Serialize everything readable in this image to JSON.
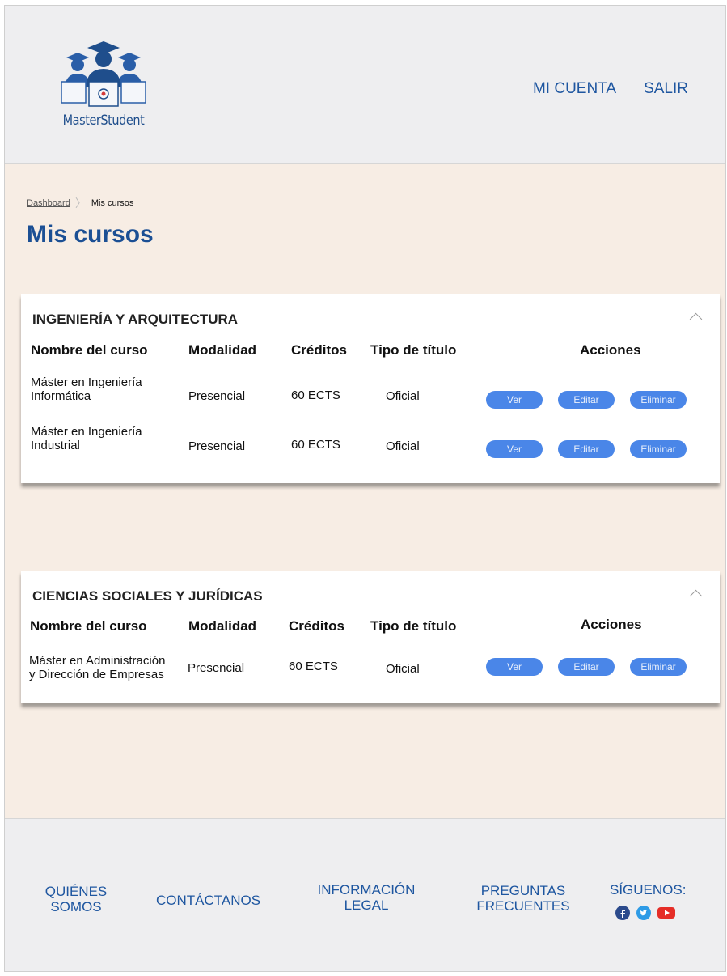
{
  "header": {
    "logo_text": "MasterStudent",
    "nav": [
      "MI CUENTA",
      "SALIR"
    ]
  },
  "breadcrumb": {
    "link": "Dashboard",
    "current": "Mis cursos"
  },
  "page_title": "Mis cursos",
  "columns": [
    "Nombre del curso",
    "Modalidad",
    "Créditos",
    "Tipo de título",
    "Acciones"
  ],
  "actions": [
    "Ver",
    "Editar",
    "Eliminar"
  ],
  "sections": [
    {
      "title": "INGENIERÍA Y ARQUITECTURA",
      "rows": [
        {
          "name_line1": "Máster en Ingeniería",
          "name_line2": "Informática",
          "modalidad": "Presencial",
          "creditos": "60 ECTS",
          "tipo": "Oficial"
        },
        {
          "name_line1": "Máster en Ingeniería",
          "name_line2": "Industrial",
          "modalidad": "Presencial",
          "creditos": "60 ECTS",
          "tipo": "Oficial"
        }
      ]
    },
    {
      "title": "CIENCIAS SOCIALES Y JURÍDICAS",
      "rows": [
        {
          "name_line1": "Máster en Administración",
          "name_line2": "y Dirección de Empresas",
          "modalidad": "Presencial",
          "creditos": "60 ECTS",
          "tipo": "Oficial"
        }
      ]
    }
  ],
  "footer": {
    "links": [
      {
        "line1": "QUIÉNES",
        "line2": "SOMOS"
      },
      {
        "line1": "CONTÁCTANOS",
        "line2": ""
      },
      {
        "line1": "INFORMACIÓN",
        "line2": "LEGAL"
      },
      {
        "line1": "PREGUNTAS",
        "line2": "FRECUENTES"
      }
    ],
    "follow_label": "SÍGUENOS:",
    "social_icons": [
      "facebook-icon",
      "twitter-icon",
      "youtube-icon"
    ]
  },
  "colors": {
    "brand_blue": "#1e56a0",
    "button_blue": "#4a86e8",
    "content_bg": "#f7ede4",
    "header_bg": "#eeeef0"
  }
}
